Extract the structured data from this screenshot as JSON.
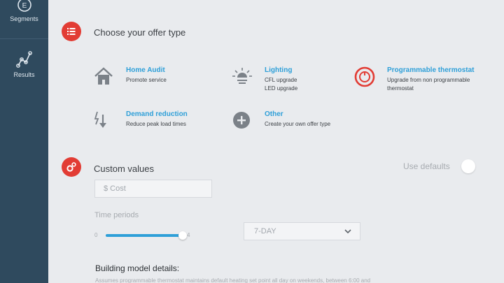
{
  "sidebar": {
    "items": [
      {
        "label": "Segments",
        "icon": "segments-icon"
      },
      {
        "label": "Results",
        "icon": "results-chart-icon"
      }
    ]
  },
  "offer_section": {
    "title": "Choose your offer type",
    "offers": [
      {
        "title": "Home Audit",
        "sub": [
          "Promote service"
        ],
        "icon": "house-icon"
      },
      {
        "title": "Lighting",
        "sub": [
          "CFL upgrade",
          "LED upgrade"
        ],
        "icon": "lightbulb-icon"
      },
      {
        "title": "Programmable thermostat",
        "sub": [
          "Upgrade from non programmable",
          "thermostat"
        ],
        "icon": "thermostat-icon"
      },
      {
        "title": "Demand reduction",
        "sub": [
          "Reduce peak load times"
        ],
        "icon": "demand-reduction-icon"
      },
      {
        "title": "Other",
        "sub": [
          "Create your own offer type"
        ],
        "icon": "plus-circle-icon"
      }
    ]
  },
  "custom_section": {
    "title": "Custom values",
    "use_defaults_label": "Use defaults",
    "cost_placeholder": "$ Cost",
    "time_periods_label": "Time periods",
    "slider_min": "0",
    "slider_max": "4",
    "slider_value_fraction": 1.0,
    "select_value": "7-DAY"
  },
  "building_model": {
    "title": "Building model details:",
    "body": "Assumes programmable thermostat maintains default heating set point all day on weekends, between 6:00 and"
  },
  "colors": {
    "sidebar": "#2f4a5e",
    "accent_red": "#e23c34",
    "accent_blue": "#2e9fd8",
    "background": "#e9ebee"
  }
}
